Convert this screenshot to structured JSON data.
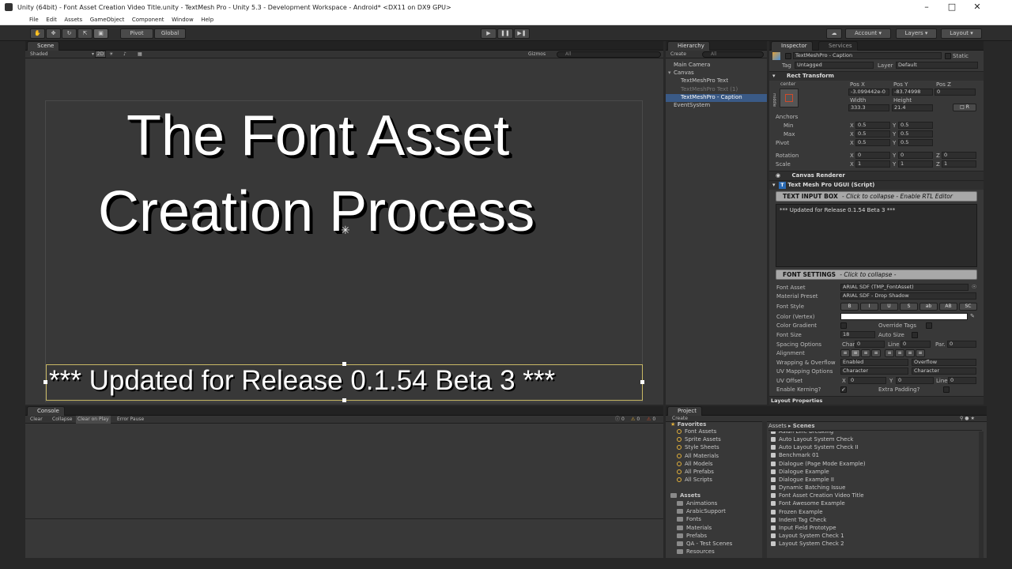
{
  "window": {
    "title": "Unity (64bit) - Font Asset Creation Video Title.unity - TextMesh Pro - Unity 5.3 - Development Workspace - Android* <DX11 on DX9 GPU>"
  },
  "menu": [
    "File",
    "Edit",
    "Assets",
    "GameObject",
    "Component",
    "Window",
    "Help"
  ],
  "toolbar": {
    "pivot": "Pivot",
    "global": "Global",
    "account": "Account",
    "layers": "Layers",
    "layout": "Layout"
  },
  "scene": {
    "tab": "Scene",
    "shaded": "Shaded",
    "mode2d": "2D",
    "gizmos": "Gizmos",
    "search": "All",
    "title_line1": "The Font Asset",
    "title_line2": "Creation Process",
    "caption": "*** Updated for Release 0.1.54 Beta 3 ***"
  },
  "hierarchy": {
    "tab": "Hierarchy",
    "create": "Create",
    "search": "All",
    "items": [
      {
        "label": "Main Camera",
        "indent": 0,
        "selected": false,
        "dim": false
      },
      {
        "label": "Canvas",
        "indent": 0,
        "selected": false,
        "dim": false
      },
      {
        "label": "TextMeshPro Text",
        "indent": 1,
        "selected": false,
        "dim": false
      },
      {
        "label": "TextMeshPro Text (1)",
        "indent": 1,
        "selected": false,
        "dim": true
      },
      {
        "label": "TextMeshPro - Caption",
        "indent": 1,
        "selected": true,
        "dim": false
      },
      {
        "label": "EventSystem",
        "indent": 0,
        "selected": false,
        "dim": false
      }
    ]
  },
  "inspector": {
    "tab": "Inspector",
    "tab2": "Services",
    "object_name": "TextMeshPro - Caption",
    "static": "Static",
    "tag_label": "Tag",
    "tag_value": "Untagged",
    "layer_label": "Layer",
    "layer_value": "Default",
    "rect_transform": "Rect Transform",
    "anchor_preset": "center",
    "anchor_side": "middle",
    "pos_x_label": "Pos X",
    "pos_y_label": "Pos Y",
    "pos_z_label": "Pos Z",
    "pos_x": "-3.099442e-0",
    "pos_y": "-83.74998",
    "pos_z": "0",
    "width_label": "Width",
    "height_label": "Height",
    "width": "333.3",
    "height": "21.4",
    "anchors": "Anchors",
    "min": "Min",
    "max": "Max",
    "pivot": "Pivot",
    "x": "X",
    "y": "Y",
    "z": "Z",
    "anchor_min_x": "0.5",
    "anchor_min_y": "0.5",
    "anchor_max_x": "0.5",
    "anchor_max_y": "0.5",
    "pivot_x": "0.5",
    "pivot_y": "0.5",
    "rotation": "Rotation",
    "rot_x": "0",
    "rot_y": "0",
    "rot_z": "0",
    "scale": "Scale",
    "scale_x": "1",
    "scale_y": "1",
    "scale_z": "1",
    "canvas_renderer": "Canvas Renderer",
    "tmp_component": "Text Mesh Pro UGUI (Script)",
    "text_input_box": "TEXT INPUT BOX",
    "text_input_hint": "- Click to collapse - Enable RTL Editor",
    "text_value": "*** Updated for Release 0.1.54 Beta 3 ***",
    "font_settings": "FONT SETTINGS",
    "font_settings_hint": "- Click to collapse -",
    "font_asset_label": "Font Asset",
    "font_asset": "ARIAL SDF (TMP_FontAsset)",
    "material_preset_label": "Material Preset",
    "material_preset": "ARIAL SDF - Drop Shadow",
    "font_style_label": "Font Style",
    "font_styles": [
      "B",
      "I",
      "U",
      "S",
      "ab",
      "AB",
      "SC"
    ],
    "color_label": "Color (Vertex)",
    "color_value": "#ffffff",
    "color_gradient": "Color Gradient",
    "override_tags": "Override Tags",
    "font_size_label": "Font Size",
    "font_size": "18",
    "auto_size": "Auto Size",
    "spacing_label": "Spacing Options",
    "char_label": "Char",
    "char": "0",
    "line_label": "Line",
    "line": "0",
    "par_label": "Par.",
    "par": "0",
    "alignment_label": "Alignment",
    "wrapping_label": "Wrapping & Overflow",
    "wrapping": "Enabled",
    "overflow": "Overflow",
    "uv_mapping_label": "UV Mapping Options",
    "uv_h": "Character",
    "uv_v": "Character",
    "uv_offset_label": "UV Offset",
    "uv_x": "0",
    "uv_y": "0",
    "uv_line_label": "Line",
    "uv_line": "0",
    "kerning": "Enable Kerning?",
    "extra_padding": "Extra Padding?",
    "layout_properties": "Layout Properties"
  },
  "console": {
    "tab": "Console",
    "clear": "Clear",
    "collapse": "Collapse",
    "clear_on_play": "Clear on Play",
    "error_pause": "Error Pause",
    "count_info": "0",
    "count_warn": "0",
    "count_err": "0"
  },
  "project": {
    "tab": "Project",
    "create": "Create",
    "favorites_label": "Favorites",
    "favorites": [
      "Font Assets",
      "Sprite Assets",
      "Style Sheets",
      "All Materials",
      "All Models",
      "All Prefabs",
      "All Scripts"
    ],
    "assets_label": "Assets",
    "folders": [
      "Animations",
      "ArabicSupport",
      "Fonts",
      "Materials",
      "Prefabs",
      "QA - Test Scenes",
      "Resources"
    ],
    "breadcrumb_root": "Assets",
    "breadcrumb_current": "Scenes",
    "scenes": [
      "Asian Line Breaking",
      "Auto Layout System Check",
      "Auto Layout System Check II",
      "Benchmark 01",
      "Dialogue (Page Mode Example)",
      "Dialogue Example",
      "Dialogue Example II",
      "Dynamic Batching Issue",
      "Font Asset Creation Video Title",
      "Font Awesome Example",
      "Frozen Example",
      "Indent Tag Check",
      "Input Field Prototype",
      "Layout System Check 1",
      "Layout System Check 2"
    ]
  }
}
